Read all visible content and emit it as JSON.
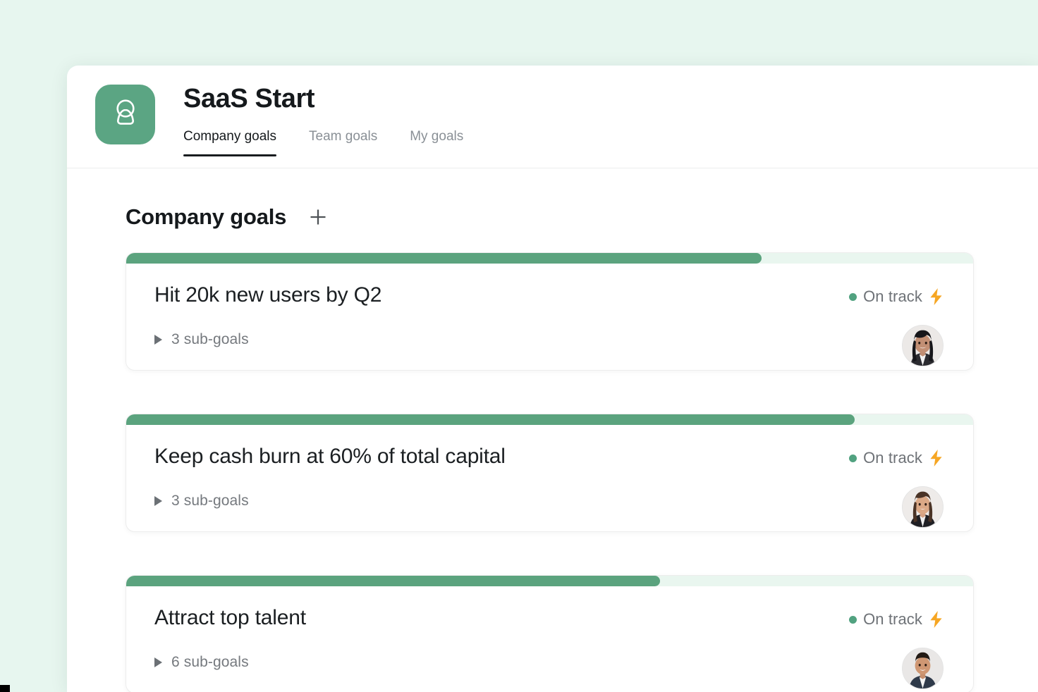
{
  "theme": {
    "page_background": "#e7f6ef",
    "panel_background": "#ffffff",
    "brand_green": "#5ba583",
    "progress_green": "#5ba37e",
    "progress_track": "#e9f6ef",
    "status_green": "#51a280",
    "bolt_orange": "#f5a623",
    "active_tab_underline": "#181c1f",
    "muted_text": "#8a9096"
  },
  "header": {
    "logo_icon": "person-avatar-icon",
    "title": "SaaS Start",
    "tabs": [
      {
        "label": "Company goals",
        "active": true
      },
      {
        "label": "Team goals",
        "active": false
      },
      {
        "label": "My goals",
        "active": false
      }
    ]
  },
  "main": {
    "section_title": "Company goals",
    "add_button_icon": "plus-icon",
    "goals": [
      {
        "title": "Hit 20k new users by Q2",
        "progress_percent": 75,
        "subgoals_label": "3 sub-goals",
        "subgoals_count": 3,
        "status_label": "On track",
        "status_emoji": "⚡",
        "status_icon": "lightning-bolt-icon",
        "disclosure_icon": "triangle-right-icon",
        "owner_avatar": "avatar-woman-dark-hair"
      },
      {
        "title": "Keep cash burn at 60% of total capital",
        "progress_percent": 86,
        "subgoals_label": "3 sub-goals",
        "subgoals_count": 3,
        "status_label": "On track",
        "status_emoji": "⚡",
        "status_icon": "lightning-bolt-icon",
        "disclosure_icon": "triangle-right-icon",
        "owner_avatar": "avatar-woman-brown-hair"
      },
      {
        "title": "Attract top talent",
        "progress_percent": 63,
        "subgoals_label": "6 sub-goals",
        "subgoals_count": 6,
        "status_label": "On track",
        "status_emoji": "⚡",
        "status_icon": "lightning-bolt-icon",
        "disclosure_icon": "triangle-right-icon",
        "owner_avatar": "avatar-man-short-hair"
      }
    ]
  }
}
